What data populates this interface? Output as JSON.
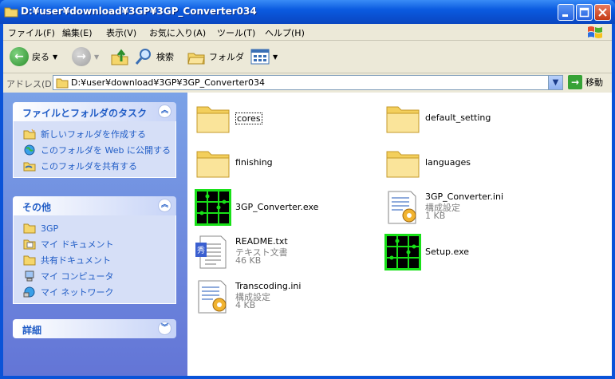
{
  "window": {
    "title": "D:¥user¥download¥3GP¥3GP_Converter034",
    "buttons": [
      "minimize-icon",
      "maximize-icon",
      "close-icon"
    ]
  },
  "menu": {
    "items": [
      "ファイル(F)",
      "編集(E)",
      "表示(V)",
      "お気に入り(A)",
      "ツール(T)",
      "ヘルプ(H)"
    ]
  },
  "toolbar": {
    "back_label": "戻る",
    "search_label": "検索",
    "folders_label": "フォルダ"
  },
  "address": {
    "label": "アドレス(D)",
    "value": "D:¥user¥download¥3GP¥3GP_Converter034",
    "go_label": "移動"
  },
  "tasks": {
    "title": "ファイルとフォルダのタスク",
    "items": [
      {
        "label": "新しいフォルダを作成する",
        "icon": "new-folder-icon"
      },
      {
        "label": "このフォルダを Web に公開する",
        "icon": "web-publish-icon"
      },
      {
        "label": "このフォルダを共有する",
        "icon": "share-folder-icon"
      }
    ]
  },
  "other": {
    "title": "その他",
    "items": [
      {
        "label": "3GP",
        "icon": "folder-icon"
      },
      {
        "label": "マイ ドキュメント",
        "icon": "my-documents-icon"
      },
      {
        "label": "共有ドキュメント",
        "icon": "folder-icon"
      },
      {
        "label": "マイ コンピュータ",
        "icon": "my-computer-icon"
      },
      {
        "label": "マイ ネットワーク",
        "icon": "my-network-icon"
      }
    ]
  },
  "details": {
    "title": "詳細"
  },
  "files": [
    {
      "name": "cores",
      "type": "folder",
      "sub1": "",
      "sub2": ""
    },
    {
      "name": "default_setting",
      "type": "folder",
      "sub1": "",
      "sub2": ""
    },
    {
      "name": "finishing",
      "type": "folder",
      "sub1": "",
      "sub2": ""
    },
    {
      "name": "languages",
      "type": "folder",
      "sub1": "",
      "sub2": ""
    },
    {
      "name": "3GP_Converter.exe",
      "type": "exe",
      "sub1": "",
      "sub2": ""
    },
    {
      "name": "3GP_Converter.ini",
      "type": "ini",
      "sub1": "構成設定",
      "sub2": "1 KB"
    },
    {
      "name": "README.txt",
      "type": "txt",
      "sub1": "テキスト文書",
      "sub2": "46 KB"
    },
    {
      "name": "Setup.exe",
      "type": "exe",
      "sub1": "",
      "sub2": ""
    },
    {
      "name": "Transcoding.ini",
      "type": "ini",
      "sub1": "構成設定",
      "sub2": "4 KB"
    }
  ]
}
